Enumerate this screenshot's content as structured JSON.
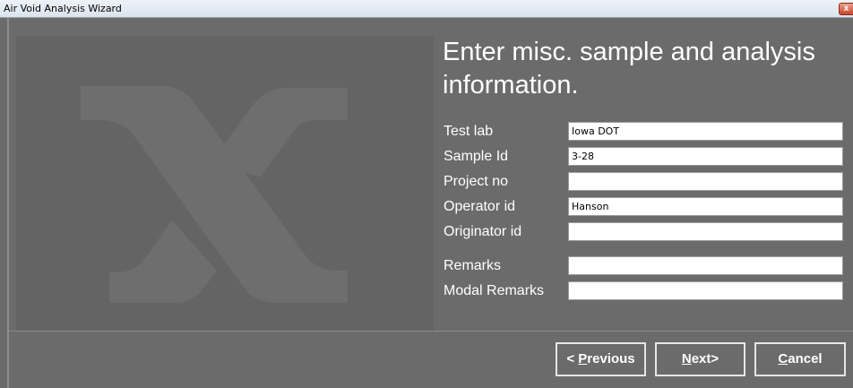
{
  "window": {
    "title": "Air Void Analysis Wizard",
    "close_glyph": "x"
  },
  "heading": "Enter misc. sample and analysis information.",
  "heading_lines": [
    "Enter misc. sample and analysis",
    "information."
  ],
  "form": {
    "fields": [
      {
        "label": "Test lab",
        "value": ""
      },
      {
        "label": "Sample Id",
        "value": ""
      },
      {
        "label": "Project no",
        "value": ""
      },
      {
        "label": "Operator id",
        "value": ""
      },
      {
        "label": "Originator id",
        "value": ""
      },
      {
        "label": "Remarks",
        "value": ""
      },
      {
        "label": "Modal Remarks",
        "value": ""
      }
    ],
    "test_lab": "Iowa DOT",
    "sample_id": "3-28",
    "project_no": "",
    "operator_id": "Hanson",
    "originator_id": "",
    "remarks": "",
    "modal_remarks": ""
  },
  "buttons": {
    "previous_prefix": "< ",
    "previous_key": "P",
    "previous_rest": "revious",
    "next_key": "N",
    "next_rest": "ext>",
    "cancel_key": "C",
    "cancel_rest": "ancel"
  },
  "colors": {
    "background": "#6b6b6b",
    "watermark_panel": "#646464",
    "watermark_logo": "#6e6e6e",
    "text": "#ffffff"
  },
  "icons": {
    "watermark": "x-logo-icon",
    "close": "close-icon"
  }
}
